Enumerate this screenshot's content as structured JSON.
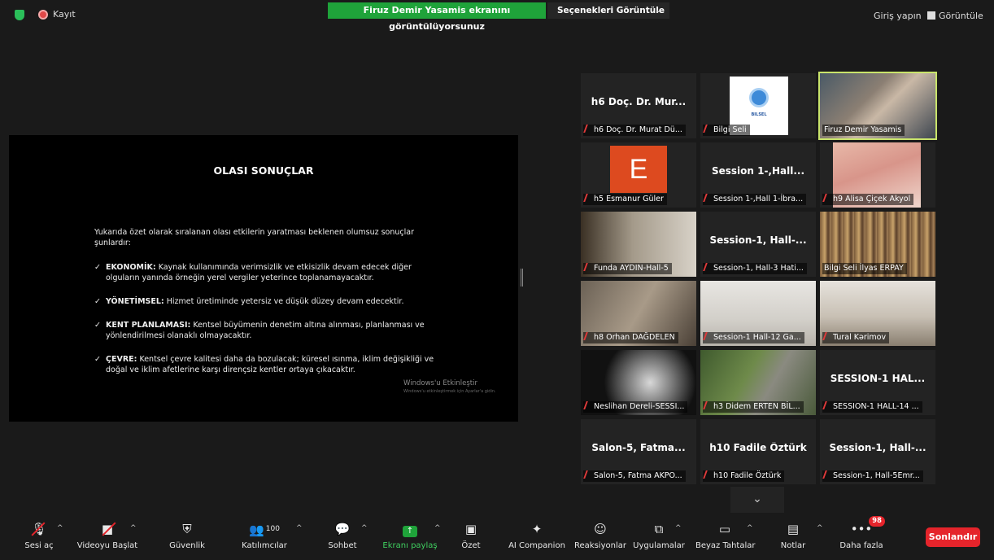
{
  "topbar": {
    "record_label": "Kayıt",
    "share_banner": "Firuz Demir Yasamis ekranını görüntülüyorsunuz",
    "view_options": "Seçenekleri Görüntüle",
    "sign_in": "Giriş yapın",
    "view": "Görüntüle"
  },
  "slide": {
    "title": "OLASI SONUÇLAR",
    "intro": "Yukarıda özet olarak sıralanan olası etkilerin yaratması beklenen olumsuz sonuçlar şunlardır:",
    "bullets": [
      {
        "head": "EKONOMİK:",
        "text": " Kaynak kullanımında verimsizlik ve etkisizlik devam edecek diğer olguların yanında örneğin yerel vergiler yeterince toplanamayacaktır."
      },
      {
        "head": "YÖNETİMSEL:",
        "text": " Hizmet üretiminde yetersiz ve düşük düzey devam edecektir."
      },
      {
        "head": "KENT PLANLAMASI:",
        "text": " Kentsel büyümenin denetim altına alınması, planlanması ve yönlendirilmesi olanaklı olmayacaktır."
      },
      {
        "head": "ÇEVRE:",
        "text": " Kentsel çevre kalitesi daha da bozulacak; küresel ısınma, iklim değişikliği ve doğal ve iklim afetlerine karşı dirençsiz kentler ortaya çıkacaktır."
      }
    ],
    "watermark": "Windows'u Etkinleştir",
    "watermark_sub": "Windows'u etkinleştirmek için Ayarlar'a gidin."
  },
  "gallery": [
    {
      "big": "h6 Doç. Dr. Mur...",
      "caption": "h6 Doç. Dr. Murat Dü..."
    },
    {
      "big": "",
      "caption": "Bilgi Seli",
      "logo_text": "BILSEL"
    },
    {
      "big": "",
      "caption": "Firuz Demir Yasamis"
    },
    {
      "big": "",
      "caption": "h5 Esmanur Güler",
      "avatar": "E"
    },
    {
      "big": "Session 1-,Hall...",
      "caption": "Session 1-,Hall 1-İbra..."
    },
    {
      "big": "",
      "caption": "h9 Alisa Çiçek Akyol"
    },
    {
      "big": "",
      "caption": "Funda AYDIN-Hall-5"
    },
    {
      "big": "Session-1, Hall-...",
      "caption": "Session-1, Hall-3 Hati..."
    },
    {
      "big": "",
      "caption": "Bilgi Seli İlyas ERPAY"
    },
    {
      "big": "",
      "caption": "h8 Orhan DAĞDELEN"
    },
    {
      "big": "",
      "caption": "Session-1 Hall-12 Ga..."
    },
    {
      "big": "",
      "caption": "Tural Kərimov"
    },
    {
      "big": "",
      "caption": "Neslihan Dereli-SESSI..."
    },
    {
      "big": "",
      "caption": "h3 Didem ERTEN BİL..."
    },
    {
      "big": "SESSION-1 HAL...",
      "caption": "SESSION-1 HALL-14 ..."
    },
    {
      "big": "Salon-5, Fatma...",
      "caption": "Salon-5, Fatma AKPO..."
    },
    {
      "big": "h10 Fadile Öztürk",
      "caption": "h10 Fadile Öztürk"
    },
    {
      "big": "Session-1, Hall-...",
      "caption": "Session-1, Hall-5Emr..."
    }
  ],
  "toolbar": {
    "unmute": "Sesi aç",
    "start_video": "Videoyu Başlat",
    "security": "Güvenlik",
    "participants": "Katılımcılar",
    "participant_count": "100",
    "chat": "Sohbet",
    "share": "Ekranı paylaş",
    "summary": "Özet",
    "ai": "AI Companion",
    "reactions": "Reaksiyonlar",
    "apps": "Uygulamalar",
    "whiteboards": "Beyaz Tahtalar",
    "notes": "Notlar",
    "more": "Daha fazla",
    "more_badge": "98",
    "end": "Sonlandır"
  }
}
